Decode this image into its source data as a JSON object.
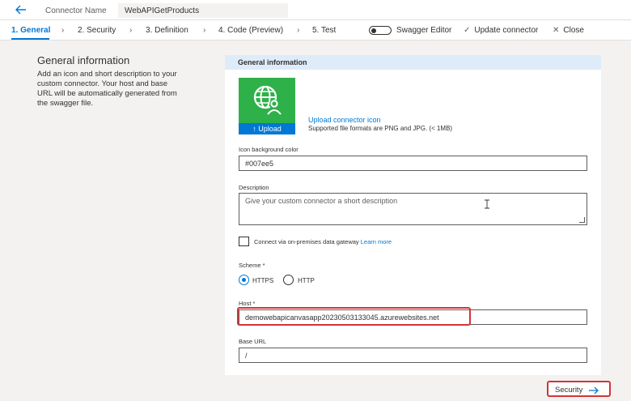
{
  "header": {
    "connector_label": "Connector Name",
    "connector_name": "WebAPIGetProducts"
  },
  "tabs": [
    {
      "label": "1. General",
      "active": true
    },
    {
      "label": "2. Security",
      "active": false
    },
    {
      "label": "3. Definition",
      "active": false
    },
    {
      "label": "4. Code (Preview)",
      "active": false
    },
    {
      "label": "5. Test",
      "active": false
    }
  ],
  "toolbar": {
    "swagger_label": "Swagger Editor",
    "update_label": "Update connector",
    "close_label": "Close"
  },
  "info": {
    "title": "General information",
    "description": "Add an icon and short description to your custom connector. Your host and base URL will be automatically generated from the swagger file."
  },
  "card": {
    "header": "General information",
    "upload_button": "Upload",
    "upload_link": "Upload connector icon",
    "upload_note": "Supported file formats are PNG and JPG. (< 1MB)",
    "icon_bg_label": "Icon background color",
    "icon_bg_value": "#007ee5",
    "description_label": "Description",
    "description_placeholder": "Give your custom connector a short description",
    "gateway_text": "Connect via on-premises data gateway",
    "gateway_link": "Learn more",
    "scheme_label": "Scheme *",
    "scheme_https": "HTTPS",
    "scheme_http": "HTTP",
    "host_label": "Host *",
    "host_value": "demowebapicanvasapp20230503133045.azurewebsites.net",
    "base_url_label": "Base URL",
    "base_url_value": "/"
  },
  "footer": {
    "security_button": "Security"
  },
  "colors": {
    "accent": "#0078d4",
    "icon_green": "#2fb14a",
    "highlight": "#d13438"
  }
}
